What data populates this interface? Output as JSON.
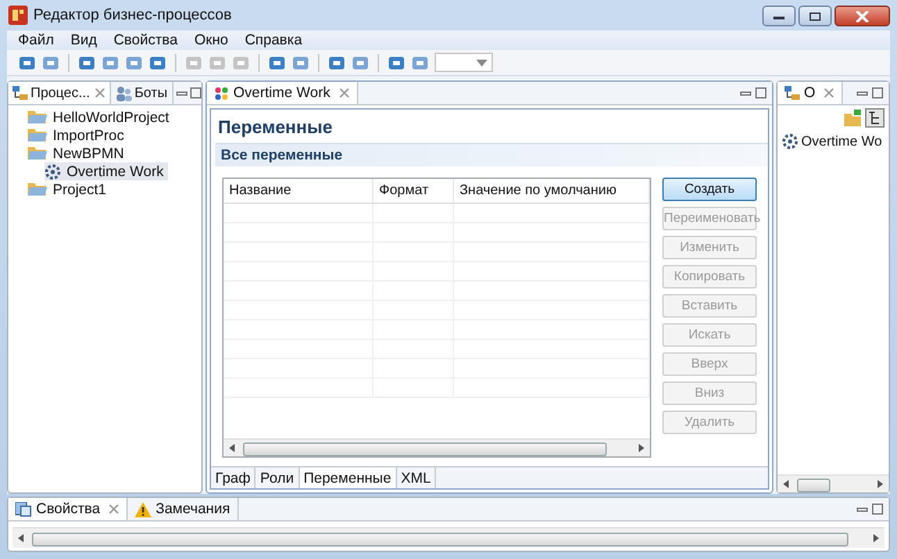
{
  "window": {
    "title": "Редактор бизнес-процессов"
  },
  "menu": [
    "Файл",
    "Вид",
    "Свойства",
    "Окно",
    "Справка"
  ],
  "left_panel": {
    "tabs": [
      {
        "label": "Процес...",
        "kind": "processes",
        "selected": true
      },
      {
        "label": "Боты",
        "kind": "bots",
        "selected": false
      }
    ],
    "tree": [
      {
        "label": "HelloWorldProject",
        "kind": "folder",
        "selected": false
      },
      {
        "label": "ImportProc",
        "kind": "folder",
        "selected": false
      },
      {
        "label": "NewBPMN",
        "kind": "folder",
        "selected": false,
        "children": [
          {
            "label": "Overtime Work",
            "kind": "process",
            "selected": true
          }
        ]
      },
      {
        "label": "Project1",
        "kind": "folder",
        "selected": false
      }
    ]
  },
  "editor": {
    "tab": "Overtime Work",
    "title": "Переменные",
    "section": "Все переменные",
    "columns": [
      "Название",
      "Формат",
      "Значение по умолчанию"
    ],
    "buttons": [
      {
        "label": "Создать",
        "disabled": false
      },
      {
        "label": "Переименовать",
        "disabled": true
      },
      {
        "label": "Изменить",
        "disabled": true
      },
      {
        "label": "Копировать",
        "disabled": true
      },
      {
        "label": "Вставить",
        "disabled": true
      },
      {
        "label": "Искать",
        "disabled": true
      },
      {
        "label": "Вверх",
        "disabled": true
      },
      {
        "label": "Вниз",
        "disabled": true
      },
      {
        "label": "Удалить",
        "disabled": true
      }
    ],
    "bottom_tabs": [
      {
        "label": "Граф",
        "selected": false
      },
      {
        "label": "Роли",
        "selected": false
      },
      {
        "label": "Переменные",
        "selected": true
      },
      {
        "label": "XML",
        "selected": false
      }
    ]
  },
  "right_panel": {
    "tab": "O",
    "tree": [
      {
        "label": "Overtime Wo",
        "kind": "process"
      }
    ]
  },
  "bottom_panel": {
    "tabs": [
      {
        "label": "Свойства",
        "kind": "properties",
        "selected": true
      },
      {
        "label": "Замечания",
        "kind": "warnings",
        "selected": false
      }
    ]
  }
}
